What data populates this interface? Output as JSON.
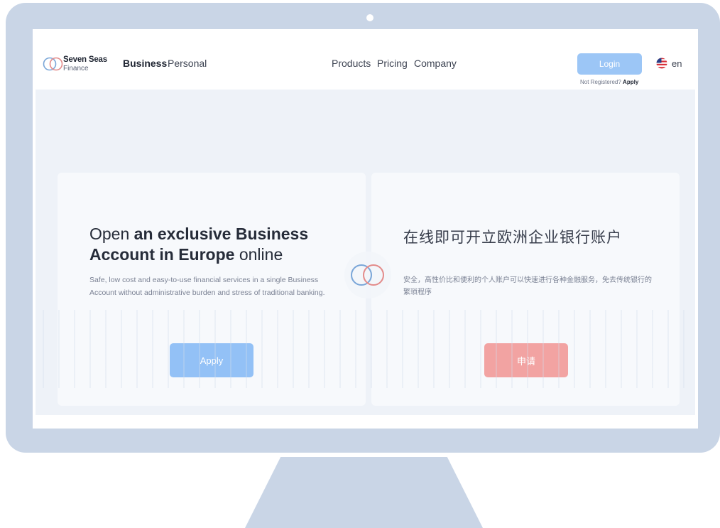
{
  "brand": {
    "name": "Seven Seas",
    "sub": "Finance",
    "colors": {
      "blue": "#7aa6d8",
      "red": "#e38b8a"
    }
  },
  "nav": {
    "business": "Business",
    "personal": "Personal",
    "products": "Products",
    "pricing": "Pricing",
    "company": "Company",
    "login": "Login",
    "not_registered": "Not Registered?",
    "apply": "Apply",
    "lang": "en",
    "lang_icon": "us-flag-icon"
  },
  "hero": {
    "left": {
      "title_pre": "Open ",
      "title_bold": "an exclusive Business Account in Europe",
      "title_post": " online",
      "description": "Safe, low cost and easy-to-use financial services in a single Business Account without administrative burden and stress of traditional banking.",
      "button": "Apply",
      "button_color": "#93c1f6"
    },
    "right": {
      "title": "在线即可开立欧洲企业银行账户",
      "description": "安全，高性价比和便利的个人账户可以快速进行各种金融服务，免去传统银行的繁琐程序",
      "button": "申请",
      "button_color": "#f2a3a2"
    }
  }
}
